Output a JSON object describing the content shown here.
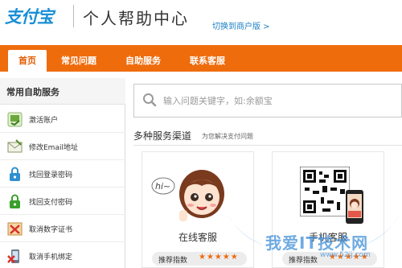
{
  "header": {
    "logo_text": "支付宝",
    "title": "个人帮助中心",
    "switch_link": "切换到商户版 >"
  },
  "nav": {
    "tabs": [
      {
        "label": "首页",
        "active": true
      },
      {
        "label": "常见问题",
        "active": false
      },
      {
        "label": "自助服务",
        "active": false
      },
      {
        "label": "联系客服",
        "active": false
      }
    ]
  },
  "sidebar": {
    "title": "常用自助服务",
    "items": [
      {
        "label": "激活账户",
        "icon": "activate-account-icon",
        "color": "#5a9f2f"
      },
      {
        "label": "修改Email地址",
        "icon": "email-icon",
        "color": "#7d9a5a"
      },
      {
        "label": "找回登录密码",
        "icon": "lock-icon",
        "color": "#2f8fd0"
      },
      {
        "label": "找回支付密码",
        "icon": "payment-password-icon",
        "color": "#3aa02c"
      },
      {
        "label": "取消数字证书",
        "icon": "cancel-certificate-icon",
        "color": "#d9502a"
      },
      {
        "label": "取消手机绑定",
        "icon": "phone-unbind-icon",
        "color": "#d9502a"
      }
    ]
  },
  "search": {
    "placeholder": "输入问题关键字，如:余额宝"
  },
  "channels": {
    "title": "多种服务渠道",
    "subtitle": "为您解决支付问题",
    "cards": [
      {
        "name": "在线客服",
        "rating_label": "推荐指数",
        "stars": "★★★★★",
        "rating": 5,
        "icon": "online-service-avatar-icon",
        "bubble": "hi~"
      },
      {
        "name": "手机客服",
        "rating_label": "推荐指数",
        "stars": "★★★★★",
        "rating": 5,
        "icon": "qr-code-icon"
      }
    ]
  },
  "watermark": {
    "text": "我爱IT技术网",
    "url": "www.52ij.com"
  },
  "colors": {
    "brand_orange": "#ef6c0d",
    "brand_blue": "#1a8fd6",
    "star": "#f06a0f"
  }
}
